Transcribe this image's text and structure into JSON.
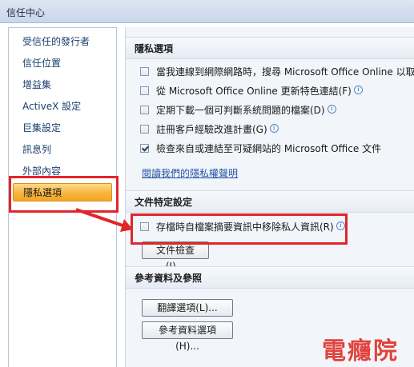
{
  "window": {
    "title": "信任中心"
  },
  "sidebar": {
    "items": [
      {
        "label": "受信任的發行者"
      },
      {
        "label": "信任位置"
      },
      {
        "label": "增益集"
      },
      {
        "label": "ActiveX 設定"
      },
      {
        "label": "巨集設定"
      },
      {
        "label": "訊息列"
      },
      {
        "label": "外部內容"
      },
      {
        "label": "隱私選項",
        "selected": true
      }
    ]
  },
  "privacy": {
    "header": "隱私選項",
    "options": [
      {
        "label": "當我連線到網際網路時，搜尋 Microsoft Office Online 以取得",
        "checked": false
      },
      {
        "label": "從 Microsoft Office Online 更新特色連結(F)",
        "checked": false
      },
      {
        "label": "定期下載一個可判斷系統問題的檔案(D)",
        "checked": false
      },
      {
        "label": "註冊客戶經驗改進計畫(G)",
        "checked": false
      },
      {
        "label": "檢查來自或連結至可疑網站的 Microsoft Office 文件",
        "checked": true
      }
    ],
    "statement_link": "閱讀我們的隱私權聲明"
  },
  "document_specific": {
    "header": "文件特定設定",
    "option": {
      "label": "存檔時自檔案摘要資訊中移除私人資訊(R)",
      "checked": false
    },
    "inspector_button": "文件檢查(I)..."
  },
  "research": {
    "header": "參考資料及參照",
    "translate_button": "翻譯選項(L)...",
    "research_button": "參考資料選項(H)..."
  },
  "watermark": "電癮院",
  "colors": {
    "callout": "#e1262b",
    "selected_bg": "#f7b63e",
    "link": "#2455a8"
  }
}
